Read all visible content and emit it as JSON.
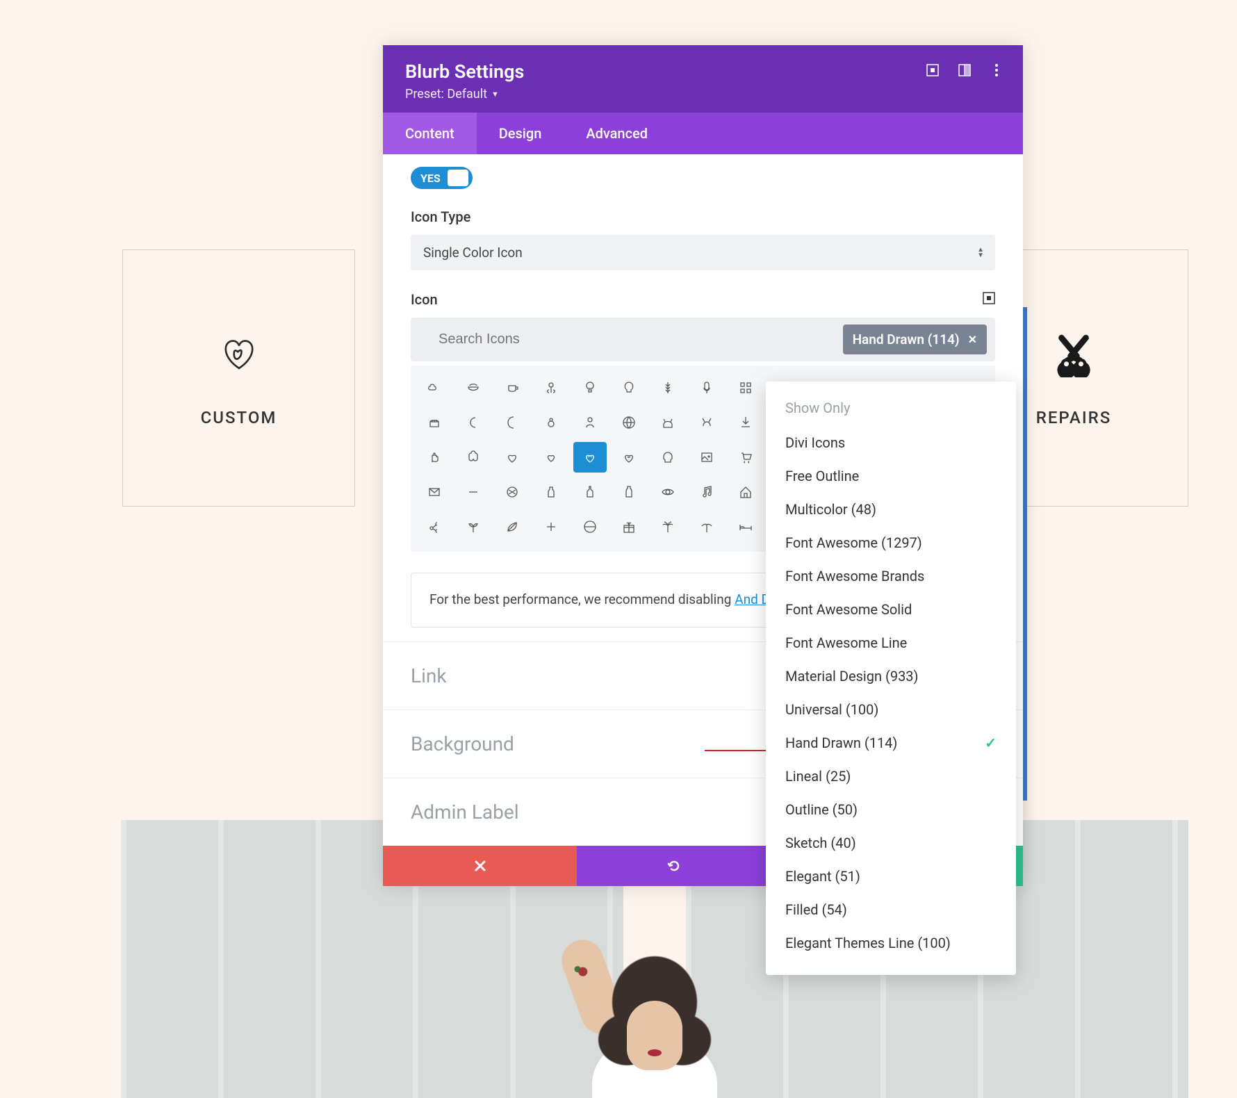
{
  "background": {
    "leftCard": {
      "label": "CUSTOM",
      "icon": "heart-leaf"
    },
    "rightCard": {
      "label": "REPAIRS",
      "icon": "scissors"
    }
  },
  "modal": {
    "title": "Blurb Settings",
    "preset": "Preset: Default",
    "tabs": {
      "content": "Content",
      "design": "Design",
      "advanced": "Advanced"
    },
    "toggle": {
      "label": "YES"
    },
    "iconType": {
      "label": "Icon Type",
      "value": "Single Color Icon"
    },
    "icon": {
      "label": "Icon",
      "searchPlaceholder": "Search Icons",
      "filterChip": "Hand Drawn (114)"
    },
    "perfNote": {
      "prefix": "For the best performance, we recommend disabling",
      "linkText": "And Divi Icons Pro plugin settings page",
      "suffix": "."
    },
    "sections": [
      "Link",
      "Background",
      "Admin Label"
    ]
  },
  "dropdown": {
    "header": "Show Only",
    "items": [
      {
        "label": "Divi Icons",
        "checked": false
      },
      {
        "label": "Free Outline",
        "checked": false
      },
      {
        "label": "Multicolor (48)",
        "checked": false
      },
      {
        "label": "Font Awesome (1297)",
        "checked": false
      },
      {
        "label": "Font Awesome Brands",
        "checked": false
      },
      {
        "label": "Font Awesome Solid",
        "checked": false
      },
      {
        "label": "Font Awesome Line",
        "checked": false
      },
      {
        "label": "Material Design (933)",
        "checked": false
      },
      {
        "label": "Universal (100)",
        "checked": false
      },
      {
        "label": "Hand Drawn (114)",
        "checked": true
      },
      {
        "label": "Lineal (25)",
        "checked": false
      },
      {
        "label": "Outline (50)",
        "checked": false
      },
      {
        "label": "Sketch (40)",
        "checked": false
      },
      {
        "label": "Elegant (51)",
        "checked": false
      },
      {
        "label": "Filled (54)",
        "checked": false
      },
      {
        "label": "Elegant Themes Line (100)",
        "checked": false
      }
    ]
  },
  "iconGrid": {
    "rows": 6,
    "cols": 9,
    "selectedIndex": 22,
    "iconShapes": [
      "cloud",
      "bowl",
      "cup",
      "flower",
      "bulb",
      "bulb2",
      "wheat",
      "mic",
      "grid",
      "cake",
      "moon",
      "cresc",
      "snowman",
      "person",
      "globe",
      "dog",
      "goat",
      "download",
      "hand",
      "brain",
      "heart1",
      "heart2",
      "heartleaf",
      "heartsel",
      "skull",
      "image",
      "cart2",
      "mail",
      "minus",
      "ball",
      "bottle1",
      "bottle2",
      "bottle3",
      "eye",
      "music",
      "house",
      "share",
      "sprout",
      "leaf",
      "plus",
      "globe2",
      "gift",
      "palm",
      "palm2",
      "bed",
      "circle1",
      "circle2",
      "circle3",
      "butterfly",
      "dots",
      "globe3",
      "person2",
      "car",
      "square"
    ]
  }
}
